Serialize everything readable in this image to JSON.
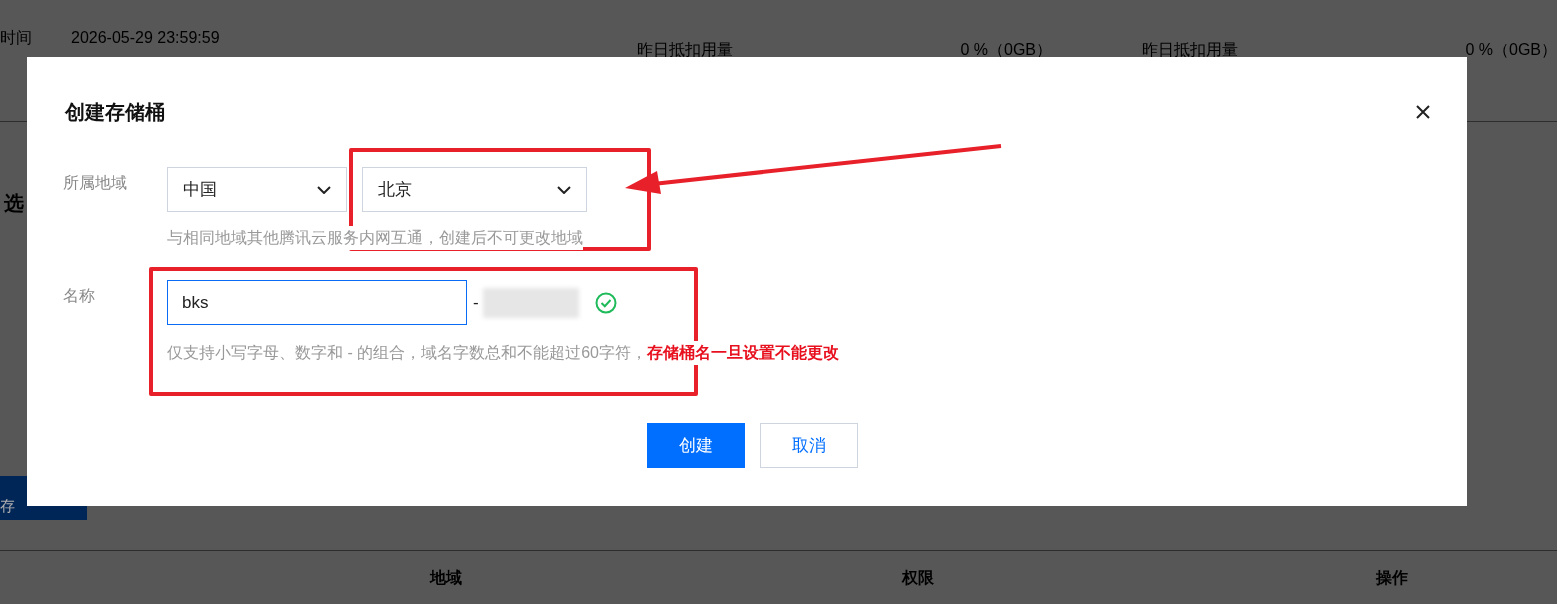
{
  "background": {
    "info_rows": [
      {
        "label": "时间",
        "value": "2026-05-29 23:59:59"
      }
    ],
    "usage": [
      {
        "label": "昨日抵扣用量",
        "value": "0 %（0GB）"
      },
      {
        "label": "昨日抵扣用量",
        "value": "0 %（0GB）"
      }
    ],
    "section_title": "选",
    "button": "存",
    "table_columns": [
      "地域",
      "权限",
      "操作"
    ]
  },
  "dialog": {
    "title": "创建存储桶",
    "region": {
      "label": "所属地域",
      "selects": [
        {
          "value": "中国"
        },
        {
          "value": "北京"
        }
      ],
      "hint": "与相同地域其他腾讯云服务内网互通，创建后不可更改地域"
    },
    "name": {
      "label": "名称",
      "value": "bks",
      "separator": "-",
      "valid": true,
      "hint": "仅支持小写字母、数字和 - 的组合，域名字数总和不能超过60字符，",
      "warning": "存储桶名一旦设置不能更改"
    },
    "buttons": [
      {
        "label": "创建",
        "kind": "primary"
      },
      {
        "label": "取消",
        "kind": "secondary"
      }
    ]
  }
}
